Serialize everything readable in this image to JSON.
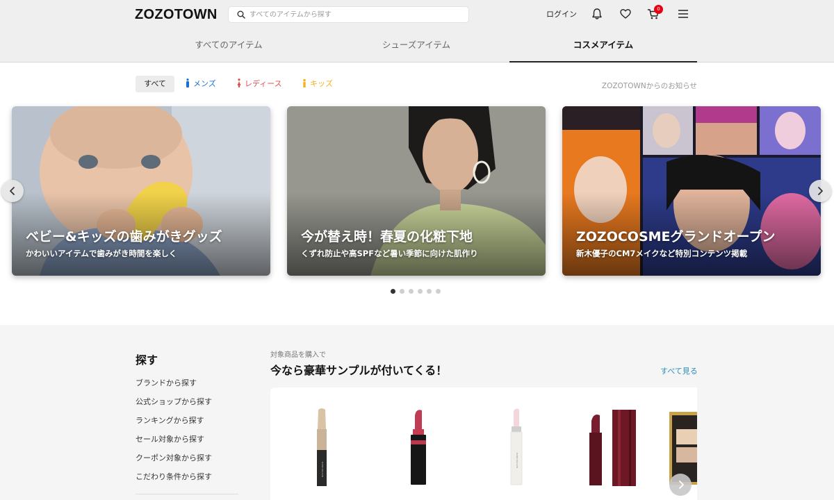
{
  "header": {
    "logo": "ZOZOTOWN",
    "search_placeholder": "すべてのアイテムから探す",
    "login_label": "ログイン",
    "cart_count": "0",
    "tabs": [
      {
        "label": "すべてのアイテム",
        "active": false
      },
      {
        "label": "シューズアイテム",
        "active": false
      },
      {
        "label": "コスメアイテム",
        "active": true
      }
    ]
  },
  "filters": {
    "all": "すべて",
    "men": "メンズ",
    "women": "レディース",
    "kids": "キッズ",
    "notice": "ZOZOTOWNからのお知らせ"
  },
  "carousel": {
    "slides": [
      {
        "title": "ベビー&キッズの歯みがきグッズ",
        "subtitle": "かわいいアイテムで歯みがき時間を楽しく"
      },
      {
        "title": "今が替え時！春夏の化粧下地",
        "subtitle": "くずれ防止や高SPFなど暑い季節に向けた肌作り"
      },
      {
        "title": "ZOZOCOSMEグランドオープン",
        "subtitle": "新木優子のCM7メイクなど特別コンテンツ掲載"
      }
    ],
    "dot_count": 6,
    "active_dot": 0
  },
  "sidebar": {
    "title": "探す",
    "links": [
      "ブランドから探す",
      "公式ショップから探す",
      "ランキングから探す",
      "セール対象から探す",
      "クーポン対象から探す",
      "こだわり条件から探す"
    ]
  },
  "featured": {
    "label": "対象商品を購入で",
    "title": "今なら豪華サンプルが付いてくる！",
    "see_all": "すべて見る",
    "products": [
      "eyeshadow-stick",
      "lipstick",
      "lip-balm",
      "lipstick-red",
      "eyeshadow-palette"
    ]
  },
  "colors": {
    "men": "#1a6fd6",
    "women": "#e04f4f",
    "kids": "#f2b21a",
    "link": "#2a8fbd",
    "badge": "#e60012"
  }
}
